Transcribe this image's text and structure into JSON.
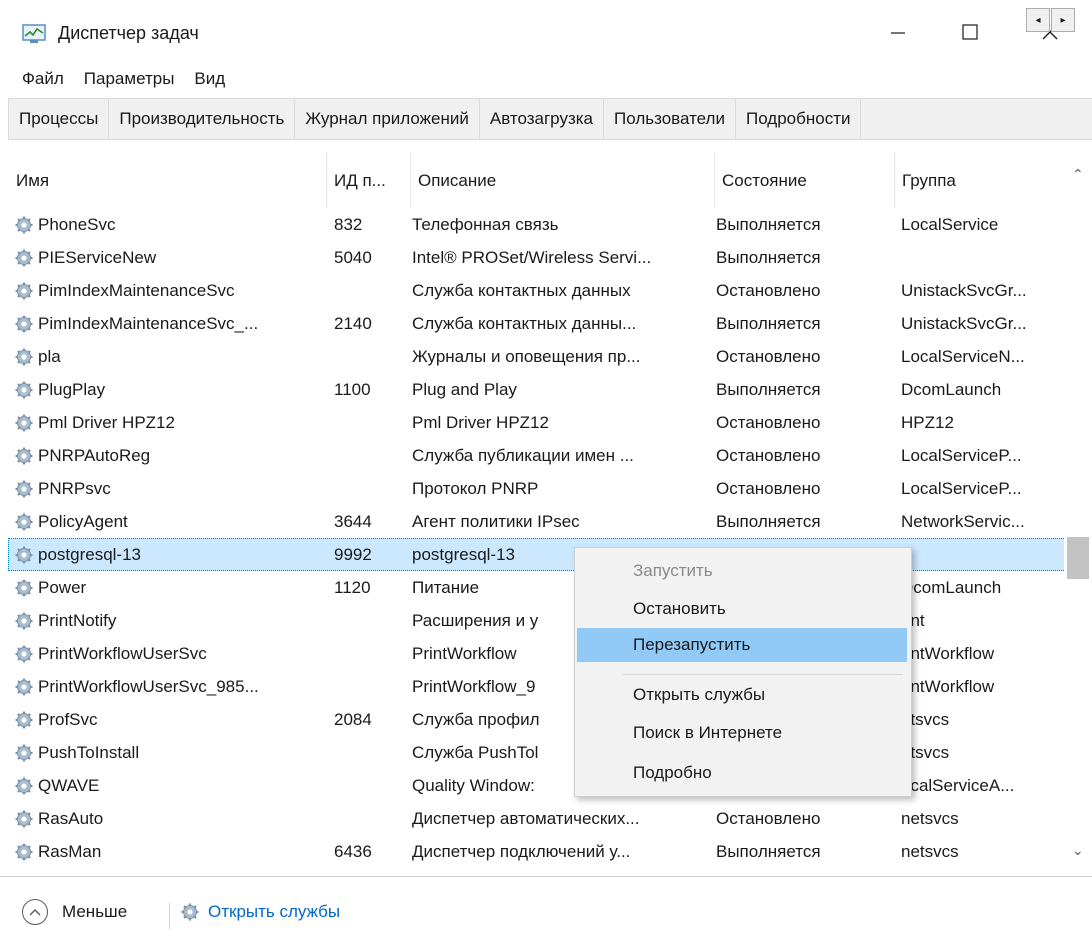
{
  "window": {
    "title": "Диспетчер задач",
    "icon": "task-manager-icon",
    "controls": [
      "minimize-icon",
      "maximize-icon",
      "close-icon"
    ]
  },
  "menu": [
    "Файл",
    "Параметры",
    "Вид"
  ],
  "tabs": [
    "Процессы",
    "Производительность",
    "Журнал приложений",
    "Автозагрузка",
    "Пользователи",
    "Подробности"
  ],
  "tab_scroll": {
    "left": "◂",
    "right": "▸"
  },
  "table": {
    "columns": [
      "Имя",
      "ИД п...",
      "Описание",
      "Состояние",
      "Группа"
    ],
    "sorted_column": "Имя",
    "rows": [
      {
        "name": "PhoneSvc",
        "pid": "832",
        "desc": "Телефонная связь",
        "state": "Выполняется",
        "group": "LocalService"
      },
      {
        "name": "PIEServiceNew",
        "pid": "5040",
        "desc": "Intel® PROSet/Wireless Servi...",
        "state": "Выполняется",
        "group": ""
      },
      {
        "name": "PimIndexMaintenanceSvc",
        "pid": "",
        "desc": "Служба контактных данных",
        "state": "Остановлено",
        "group": "UnistackSvcGr..."
      },
      {
        "name": "PimIndexMaintenanceSvc_...",
        "pid": "2140",
        "desc": "Служба контактных данны...",
        "state": "Выполняется",
        "group": "UnistackSvcGr..."
      },
      {
        "name": "pla",
        "pid": "",
        "desc": "Журналы и оповещения пр...",
        "state": "Остановлено",
        "group": "LocalServiceN..."
      },
      {
        "name": "PlugPlay",
        "pid": "1100",
        "desc": "Plug and Play",
        "state": "Выполняется",
        "group": "DcomLaunch"
      },
      {
        "name": "Pml Driver HPZ12",
        "pid": "",
        "desc": "Pml Driver HPZ12",
        "state": "Остановлено",
        "group": "HPZ12"
      },
      {
        "name": "PNRPAutoReg",
        "pid": "",
        "desc": "Служба публикации имен ...",
        "state": "Остановлено",
        "group": "LocalServiceP..."
      },
      {
        "name": "PNRPsvc",
        "pid": "",
        "desc": "Протокол PNRP",
        "state": "Остановлено",
        "group": "LocalServiceP..."
      },
      {
        "name": "PolicyAgent",
        "pid": "3644",
        "desc": "Агент политики IPsec",
        "state": "Выполняется",
        "group": "NetworkServic..."
      },
      {
        "name": "postgresql-13",
        "pid": "9992",
        "desc": "postgresql-13",
        "state": "",
        "group": "",
        "selected": true
      },
      {
        "name": "Power",
        "pid": "1120",
        "desc": "Питание",
        "state": "",
        "group": "DcomLaunch"
      },
      {
        "name": "PrintNotify",
        "pid": "",
        "desc": "Расширения и у",
        "state": "",
        "group": "rint"
      },
      {
        "name": "PrintWorkflowUserSvc",
        "pid": "",
        "desc": "PrintWorkflow",
        "state": "",
        "group": "rintWorkflow"
      },
      {
        "name": "PrintWorkflowUserSvc_985...",
        "pid": "",
        "desc": "PrintWorkflow_9",
        "state": "",
        "group": "rintWorkflow"
      },
      {
        "name": "ProfSvc",
        "pid": "2084",
        "desc": "Служба профил",
        "state": "",
        "group": "etsvcs"
      },
      {
        "name": "PushToInstall",
        "pid": "",
        "desc": "Служба PushTol",
        "state": "",
        "group": "etsvcs"
      },
      {
        "name": "QWAVE",
        "pid": "",
        "desc": "Quality Window:",
        "state": "",
        "group": "ocalServiceA..."
      },
      {
        "name": "RasAuto",
        "pid": "",
        "desc": "Диспетчер автоматических...",
        "state": "Остановлено",
        "group": "netsvcs"
      },
      {
        "name": "RasMan",
        "pid": "6436",
        "desc": "Диспетчер подключений у...",
        "state": "Выполняется",
        "group": "netsvcs"
      }
    ]
  },
  "context_menu": {
    "items": [
      {
        "label": "Запустить",
        "disabled": true
      },
      {
        "label": "Остановить"
      },
      {
        "label": "Перезапустить",
        "hover": true
      },
      {
        "label": "Открыть службы"
      },
      {
        "label": "Поиск в Интернете"
      },
      {
        "label": "Подробно"
      }
    ]
  },
  "footer": {
    "fewer_label": "Меньше",
    "open_services_label": "Открыть службы"
  }
}
